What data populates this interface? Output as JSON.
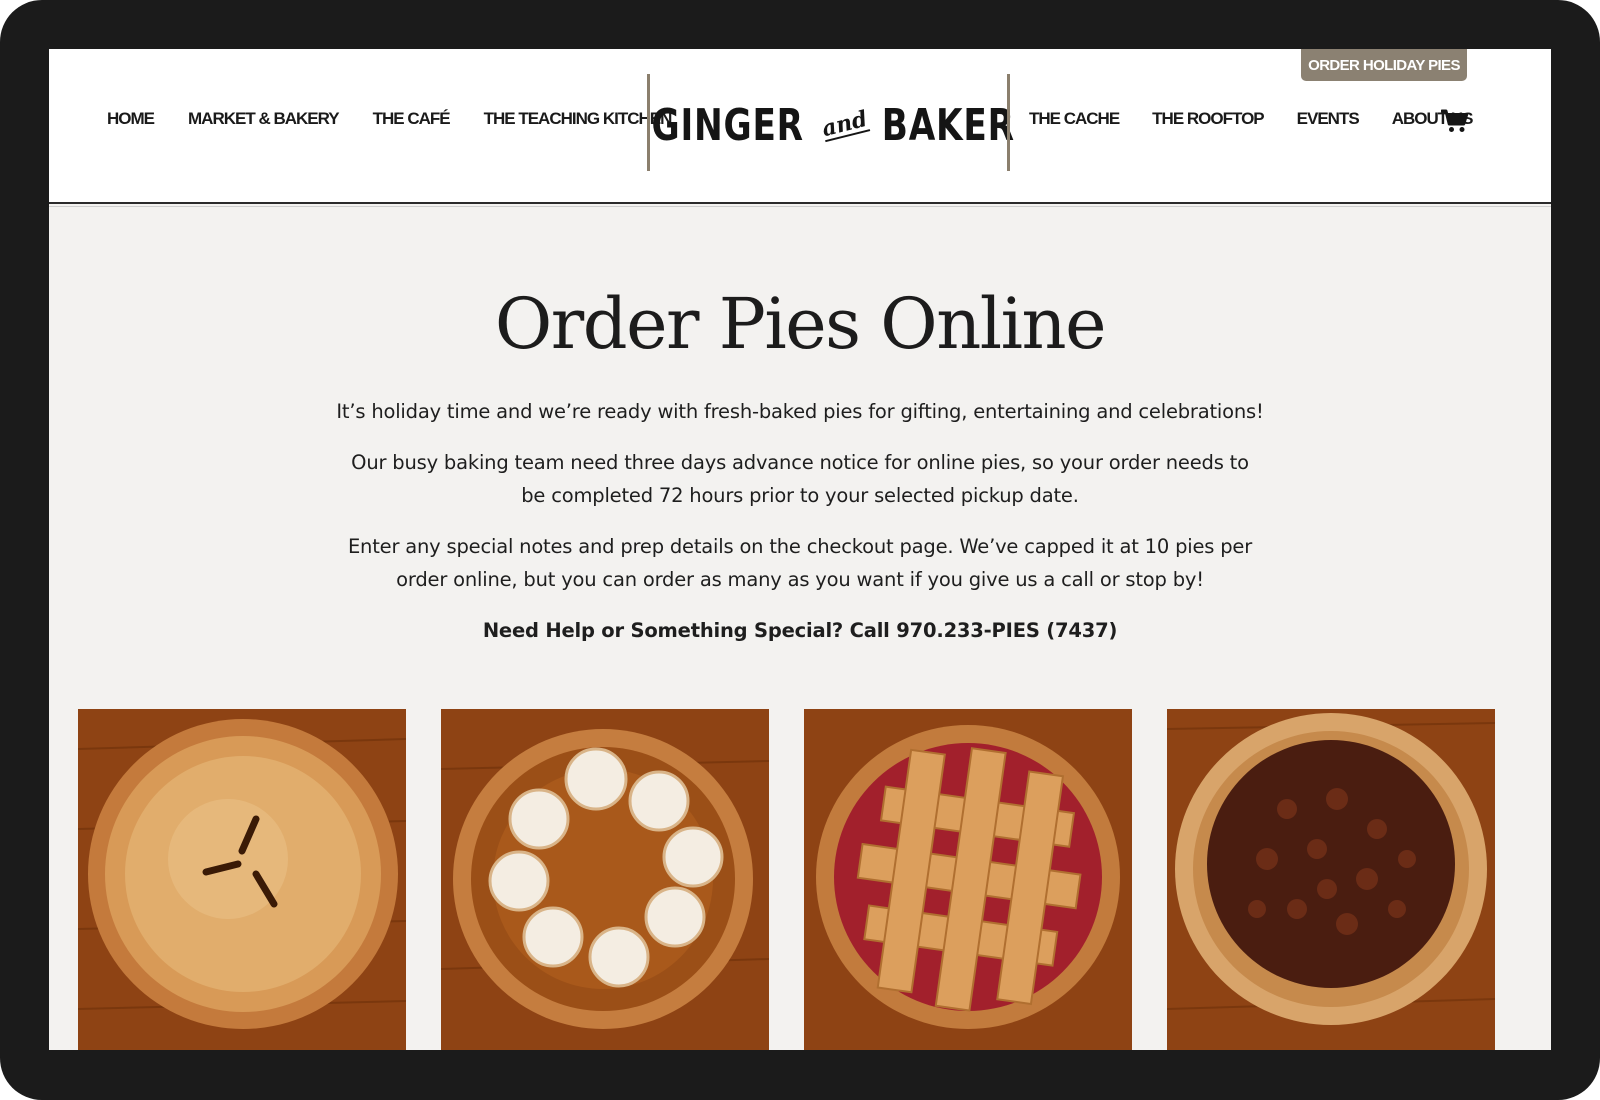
{
  "header": {
    "nav_left": [
      "HOME",
      "MARKET & BAKERY",
      "THE CAFÉ",
      "THE TEACHING KITCHEN"
    ],
    "nav_right": [
      "THE CACHE",
      "THE ROOFTOP",
      "EVENTS",
      "ABOUT US"
    ],
    "logo": {
      "word1": "GINGER",
      "and": "and",
      "word2": "BAKER"
    },
    "cart_icon": "shopping-cart-icon",
    "order_holiday_label": "ORDER HOLIDAY PIES"
  },
  "main": {
    "title": "Order Pies Online",
    "paragraphs": [
      "It’s holiday time and we’re ready with fresh-baked pies for gifting, entertaining and celebrations!",
      "Our busy baking team need three days advance notice for online pies, so your order needs to be completed 72 hours prior to your selected pickup date.",
      "Enter any special notes and prep details on the checkout page. We’ve capped it at 10 pies per order online, but you can order as many as you want if you give us a call or stop by!"
    ],
    "help_text": "Need Help or Something Special? Call 970.233-PIES (7437)"
  },
  "products": [
    {
      "image": "double-crust-pie-image"
    },
    {
      "image": "pumpkin-pie-image"
    },
    {
      "image": "lattice-cherry-pie-image"
    },
    {
      "image": "pecan-pie-image"
    }
  ],
  "colors": {
    "divider": "#8b7f6d",
    "order_button": "#8b8172",
    "page_background": "#f3f2f0",
    "wood": "#8a3e12"
  }
}
